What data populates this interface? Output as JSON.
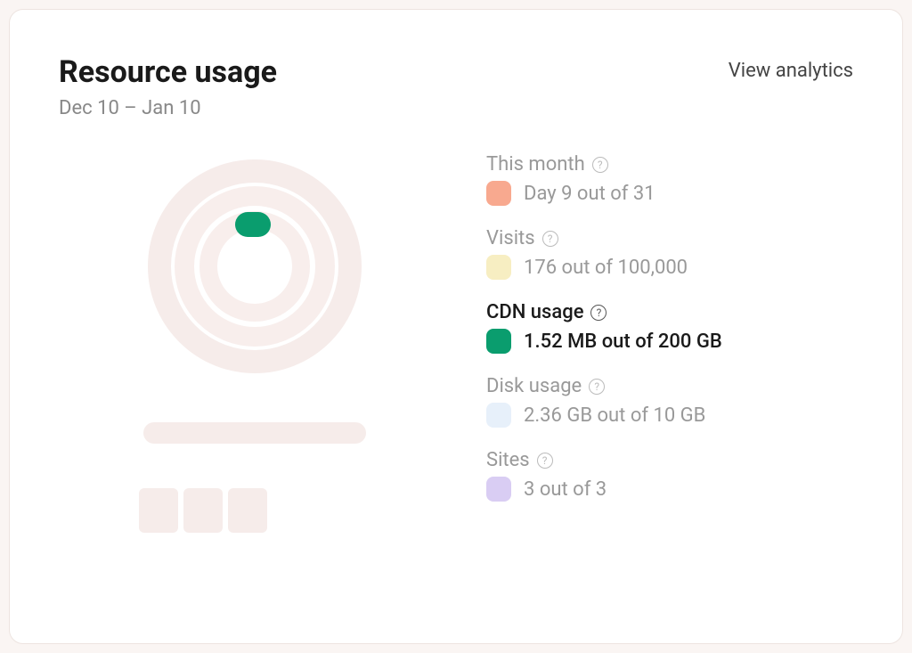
{
  "header": {
    "title": "Resource usage",
    "view_link": "View analytics",
    "date_range": "Dec 10 – Jan 10"
  },
  "metrics": [
    {
      "label": "This month",
      "value_text": "Day 9 out of 31",
      "color": "#f8a98f",
      "active": false,
      "fraction": 0.29
    },
    {
      "label": "Visits",
      "value_text": "176 out of 100,000",
      "color": "#f7eec2",
      "active": false,
      "fraction": 0.00176
    },
    {
      "label": "CDN usage",
      "value_text": "1.52 MB out of 200 GB",
      "color": "#0a9d6e",
      "active": true,
      "fraction": 7.6e-06
    },
    {
      "label": "Disk usage",
      "value_text": "2.36 GB out of 10 GB",
      "color": "#e7f0fa",
      "active": false,
      "fraction": 0.236
    },
    {
      "label": "Sites",
      "value_text": "3 out of 3",
      "color": "#d9cdf3",
      "active": false,
      "fraction": 1.0
    }
  ]
}
